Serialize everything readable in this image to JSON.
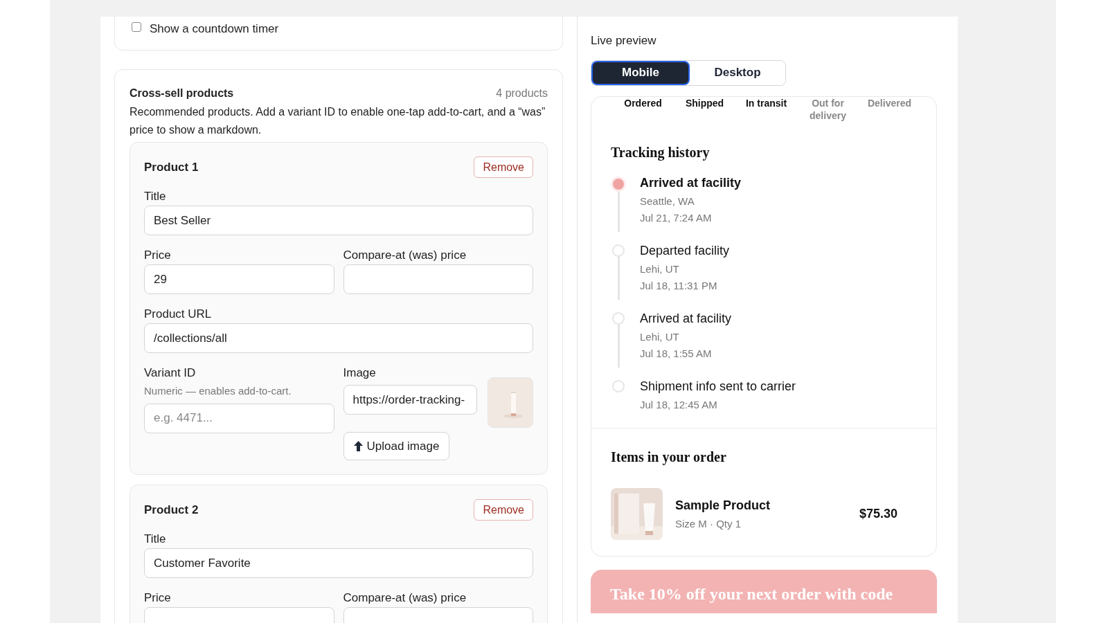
{
  "settings_card": {
    "checkbox": {
      "label": "Show a countdown timer",
      "checked": false
    }
  },
  "cross_sell": {
    "title": "Cross-sell products",
    "count": "4 products",
    "description": "Recommended products. Add a variant ID to enable one-tap add-to-cart, and a “was” price to show a markdown.",
    "products": [
      {
        "heading": "Product 1",
        "remove": "Remove",
        "title": {
          "label": "Title",
          "value": "Best Seller"
        },
        "price": {
          "label": "Price",
          "value": "29"
        },
        "compare_at": {
          "label": "Compare-at (was) price"
        },
        "url": {
          "label": "Product URL",
          "value": "/collections/all"
        },
        "variant": {
          "label": "Variant ID",
          "hint": "Numeric — enables add-to-cart.",
          "placeholder": "e.g. 4471..."
        },
        "image": {
          "label": "Image",
          "value": "https://order-tracking-",
          "upload": "Upload image"
        }
      },
      {
        "heading": "Product 2",
        "remove": "Remove",
        "title": {
          "label": "Title",
          "value": "Customer Favorite"
        },
        "price": {
          "label": "Price"
        },
        "compare_at": {
          "label": "Compare-at (was) price"
        }
      }
    ]
  },
  "preview": {
    "label": "Live preview",
    "tabs": [
      {
        "label": "Mobile",
        "selected": true
      },
      {
        "label": "Desktop",
        "selected": false
      }
    ],
    "steps": [
      {
        "label": "Ordered",
        "done": true
      },
      {
        "label": "Shipped",
        "done": true
      },
      {
        "label": "In transit",
        "done": true
      },
      {
        "label": "Out for delivery",
        "done": false
      },
      {
        "label": "Delivered",
        "done": false
      }
    ],
    "tracking_title": "Tracking history",
    "events": [
      {
        "title": "Arrived at facility",
        "location": "Seattle, WA",
        "time": "Jul 21, 7:24 AM",
        "current": true
      },
      {
        "title": "Departed facility",
        "location": "Lehi, UT",
        "time": "Jul 18, 11:31 PM",
        "current": false
      },
      {
        "title": "Arrived at facility",
        "location": "Lehi, UT",
        "time": "Jul 18, 1:55 AM",
        "current": false
      },
      {
        "title": "Shipment info sent to carrier",
        "time": "Jul 18, 12:45 AM",
        "current": false
      }
    ],
    "items_title": "Items in your order",
    "items": [
      {
        "name": "Sample Product",
        "meta": "Size M · Qty 1",
        "price": "$75.30"
      }
    ],
    "promo": "Take 10% off your next order with code"
  }
}
